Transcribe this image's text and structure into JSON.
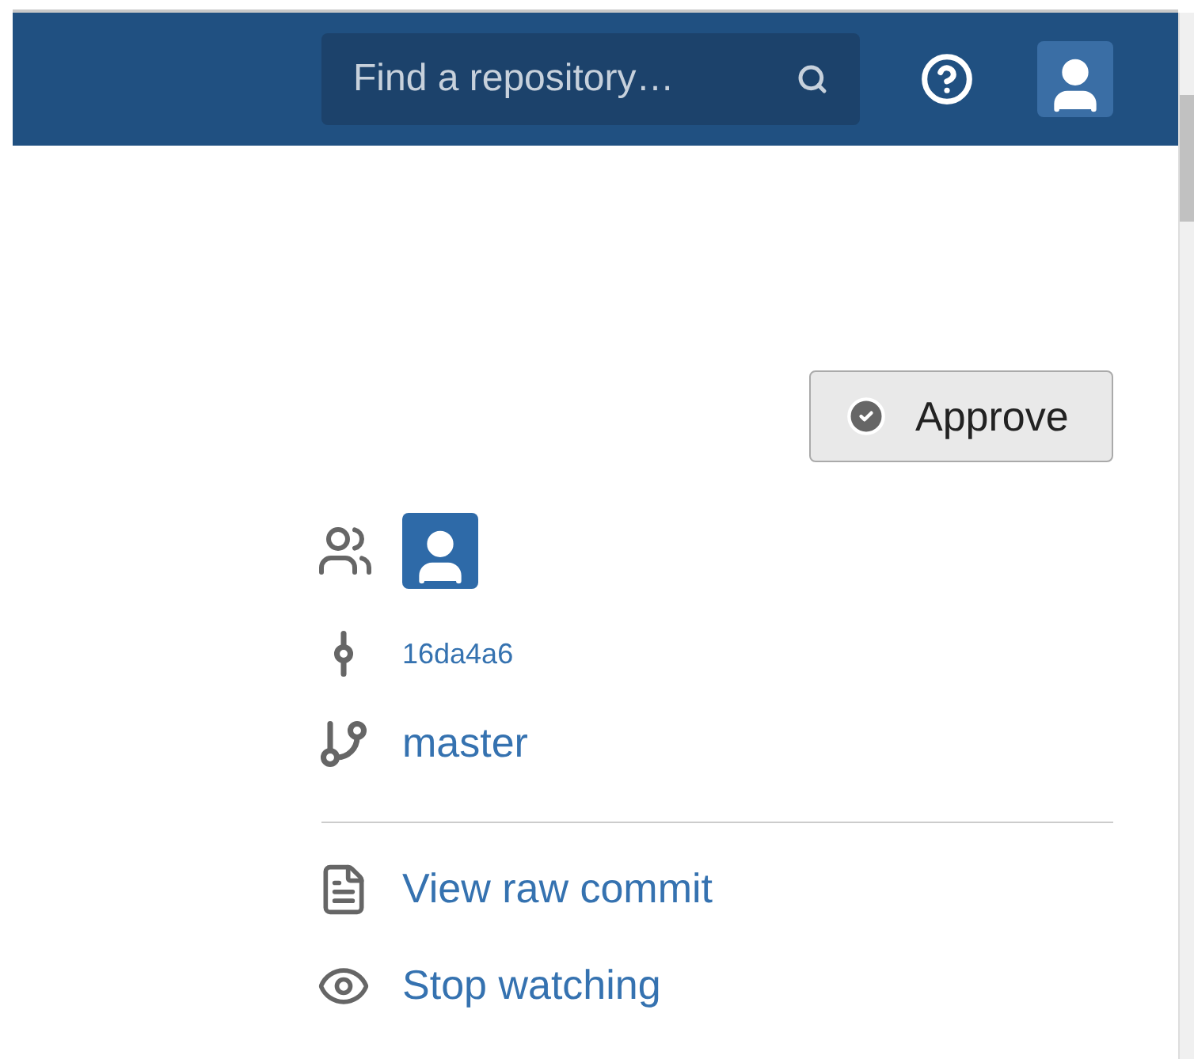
{
  "header": {
    "search": {
      "placeholder": "Find a repository…"
    }
  },
  "approve_button": {
    "label": "Approve"
  },
  "details": {
    "commit": "16da4a6",
    "branch": "master"
  },
  "actions": [
    {
      "kind": "raw",
      "label": "View raw commit"
    },
    {
      "kind": "watch",
      "label": "Stop watching"
    }
  ]
}
